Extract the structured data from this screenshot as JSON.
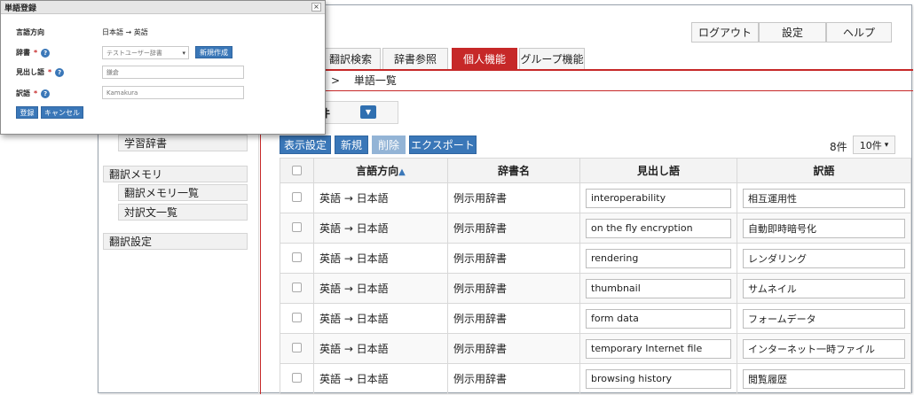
{
  "header": {
    "logout_label": "ログアウト",
    "settings_label": "設定",
    "help_label": "ヘルプ"
  },
  "tabs": [
    {
      "label": "翻訳検索"
    },
    {
      "label": "辞書参照"
    },
    {
      "label": "個人機能",
      "active": true
    },
    {
      "label": "グループ機能"
    }
  ],
  "breadcrumb": {
    "separator": ">",
    "current": "単語一覧"
  },
  "sidebar": {
    "items": [
      {
        "label": "学習辞書"
      },
      {
        "label": "翻訳メモリ"
      },
      {
        "label": "翻訳メモリ一覧"
      },
      {
        "label": "対訳文一覧"
      },
      {
        "label": "翻訳設定"
      }
    ]
  },
  "search_condition": {
    "label": "条件",
    "toggle_icon": "chevron-down-icon",
    "toggle_glyph": "▼"
  },
  "toolbar": {
    "display_settings_label": "表示設定",
    "new_label": "新規",
    "delete_label": "削除",
    "export_label": "エクスポート",
    "count_text": "8件",
    "per_page_value": "10件",
    "per_page_caret": "▾"
  },
  "table": {
    "columns": [
      "言語方向",
      "辞書名",
      "見出し語",
      "訳語"
    ],
    "sort_indicator": "▲",
    "rows": [
      {
        "direction": "英語 → 日本語",
        "dict": "例示用辞書",
        "headword": "interoperability",
        "translation": "相互運用性"
      },
      {
        "direction": "英語 → 日本語",
        "dict": "例示用辞書",
        "headword": "on the fly encryption",
        "translation": "自動即時暗号化"
      },
      {
        "direction": "英語 → 日本語",
        "dict": "例示用辞書",
        "headword": "rendering",
        "translation": "レンダリング"
      },
      {
        "direction": "英語 → 日本語",
        "dict": "例示用辞書",
        "headword": "thumbnail",
        "translation": "サムネイル"
      },
      {
        "direction": "英語 → 日本語",
        "dict": "例示用辞書",
        "headword": "form data",
        "translation": "フォームデータ"
      },
      {
        "direction": "英語 → 日本語",
        "dict": "例示用辞書",
        "headword": "temporary Internet file",
        "translation": "インターネット一時ファイル"
      },
      {
        "direction": "英語 → 日本語",
        "dict": "例示用辞書",
        "headword": "browsing history",
        "translation": "閲覧履歴"
      }
    ]
  },
  "dialog": {
    "title": "単語登録",
    "close_glyph": "×",
    "direction_label": "言語方向",
    "direction_value": "日本語 → 英語",
    "dict_label": "辞書",
    "dict_value": "テストユーザー辞書",
    "dict_caret": "▾",
    "new_dict_label": "新規作成",
    "headword_label": "見出し語",
    "headword_value": "鎌倉",
    "translation_label": "訳語",
    "translation_value": "Kamakura",
    "required_mark": "*",
    "help_glyph": "?",
    "register_label": "登録",
    "cancel_label": "キャンセル"
  },
  "colors": {
    "accent_red": "#c62828",
    "button_blue": "#3a77b8"
  }
}
